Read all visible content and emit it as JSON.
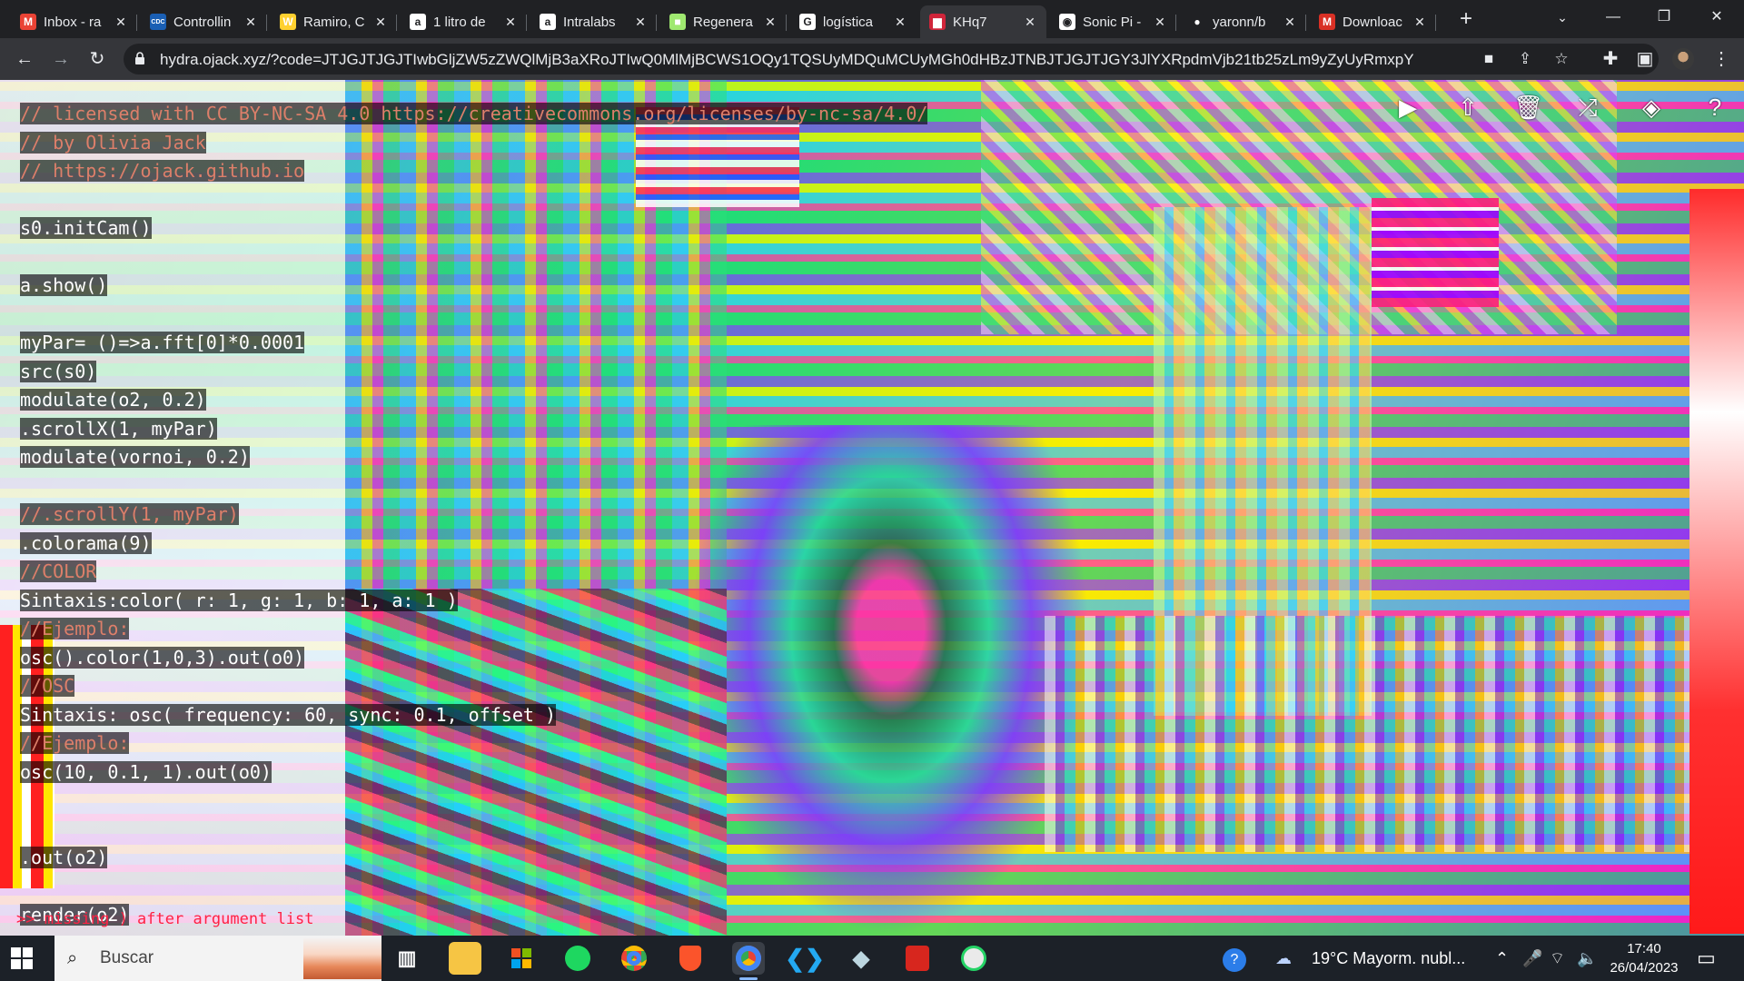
{
  "tabs": [
    {
      "title": "Inbox - ra",
      "icon": "gmail-icon",
      "color": "#ea4335",
      "glyph": "M"
    },
    {
      "title": "Controllin",
      "icon": "cdc-icon",
      "color": "#1a5fb4",
      "glyph": "CDC"
    },
    {
      "title": "Ramiro, C",
      "icon": "miro-icon",
      "color": "#ffd02f",
      "glyph": "W"
    },
    {
      "title": "1 litro de",
      "icon": "amazon-icon",
      "color": "#ffffff",
      "glyph": "a"
    },
    {
      "title": "Intralabs",
      "icon": "amazon-icon",
      "color": "#ffffff",
      "glyph": "a"
    },
    {
      "title": "Regenera",
      "icon": "regenera-icon",
      "color": "#9fe870",
      "glyph": "■"
    },
    {
      "title": "logística",
      "icon": "google-icon",
      "color": "#ffffff",
      "glyph": "G"
    },
    {
      "title": "KHq7",
      "icon": "hydra-icon",
      "color": "#d0253a",
      "glyph": "▆"
    },
    {
      "title": "Sonic Pi -",
      "icon": "globe-icon",
      "color": "#ffffff",
      "glyph": "◉"
    },
    {
      "title": "yaronn/b",
      "icon": "github-icon",
      "color": "#202124",
      "glyph": "●"
    },
    {
      "title": "Downloac",
      "icon": "gmail-icon",
      "color": "#d93025",
      "glyph": "M"
    }
  ],
  "toolbar": {
    "url": "hydra.ojack.xyz/?code=JTJGJTJGJTIwbGljZW5zZWQlMjB3aXRoJTIwQ0MlMjBCWS1OQy1TQSUyMDQuMCUyMGh0dHBzJTNBJTJGJTJGY3JlYXRpdmVjb21tb25zLm9yZyUyRmxpY2Vuc2VzJTJG..."
  },
  "code_lines": [
    {
      "text": "// licensed with CC BY-NC-SA 4.0 https://creativecommons.org/licenses/by-nc-sa/4.0/",
      "kind": "comment"
    },
    {
      "text": "// by Olivia Jack",
      "kind": "comment"
    },
    {
      "text": "// https://ojack.github.io",
      "kind": "comment"
    },
    {
      "text": "",
      "kind": "blank"
    },
    {
      "text": "s0.initCam()",
      "kind": "code"
    },
    {
      "text": "",
      "kind": "blank"
    },
    {
      "text": "a.show()",
      "kind": "code"
    },
    {
      "text": "",
      "kind": "blank"
    },
    {
      "text": "myPar= ()=>a.fft[0]*0.0001",
      "kind": "code"
    },
    {
      "text": "src(s0)",
      "kind": "code"
    },
    {
      "text": "modulate(o2, 0.2)",
      "kind": "code"
    },
    {
      "text": ".scrollX(1, myPar)",
      "kind": "code"
    },
    {
      "text": "modulate(vornoi, 0.2)",
      "kind": "code"
    },
    {
      "text": "",
      "kind": "blank"
    },
    {
      "text": "//.scrollY(1, myPar)",
      "kind": "comment"
    },
    {
      "text": ".colorama(9)",
      "kind": "code"
    },
    {
      "text": "//COLOR",
      "kind": "comment"
    },
    {
      "text": "Sintaxis:color( r: 1, g: 1, b: 1, a: 1 )",
      "kind": "code"
    },
    {
      "text": "//Ejemplo:",
      "kind": "comment"
    },
    {
      "text": "osc().color(1,0,3).out(o0)",
      "kind": "code"
    },
    {
      "text": "//OSC",
      "kind": "comment"
    },
    {
      "text": "Sintaxis: osc( frequency: 60, sync: 0.1, offset )",
      "kind": "code"
    },
    {
      "text": "//Ejemplo:",
      "kind": "comment"
    },
    {
      "text": "osc(10, 0.1, 1).out(o0)",
      "kind": "code"
    },
    {
      "text": "",
      "kind": "blank"
    },
    {
      "text": "",
      "kind": "blank"
    },
    {
      "text": ".out(o2)",
      "kind": "code"
    },
    {
      "text": "",
      "kind": "blank"
    },
    {
      "text": "render(o2)",
      "kind": "code"
    }
  ],
  "console_message": ">> missing ) after argument list",
  "taskbar": {
    "search_placeholder": "Buscar",
    "weather": "19°C  Mayorm. nubl...",
    "time": "17:40",
    "date": "26/04/2023"
  }
}
